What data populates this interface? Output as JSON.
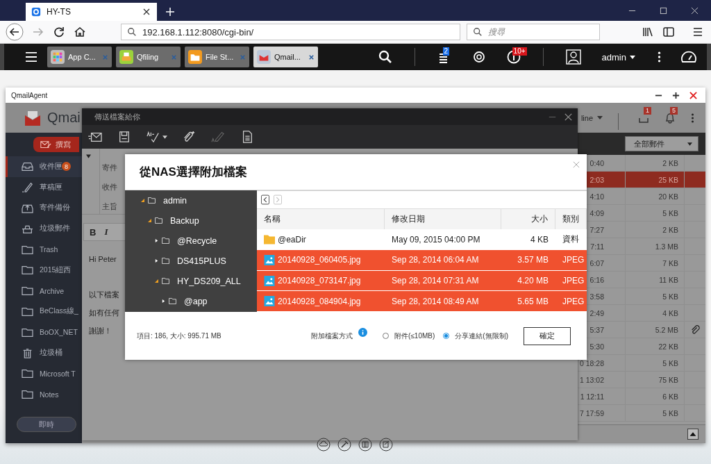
{
  "browser": {
    "tab_title": "HY-TS",
    "url": "192.168.1.112:8080/cgi-bin/",
    "search_placeholder": "搜尋"
  },
  "qts_bar": {
    "apps": [
      {
        "label": "App C...",
        "kind": "appcenter",
        "selected": false
      },
      {
        "label": "Qfiling",
        "kind": "qfiling",
        "selected": false
      },
      {
        "label": "File St...",
        "kind": "filestation",
        "selected": false
      },
      {
        "label": "Qmail...",
        "kind": "qmail",
        "selected": true
      }
    ],
    "task_badge": "2",
    "info_badge": "10+",
    "user": "admin"
  },
  "qmail_window": {
    "title": "QmailAgent",
    "logo_text": "Qmai",
    "compose_button": "撰寫",
    "folders": [
      {
        "label": "收件匣",
        "kind": "inbox",
        "count": "8",
        "selected": true
      },
      {
        "label": "草稿匣",
        "kind": "drafts",
        "selected": false
      },
      {
        "label": "寄件備份",
        "kind": "sent",
        "selected": false
      },
      {
        "label": "垃圾郵件",
        "kind": "spam",
        "selected": false
      },
      {
        "label": "Trash",
        "kind": "folder",
        "selected": false
      },
      {
        "label": "2015紐西",
        "kind": "folder",
        "selected": false
      },
      {
        "label": "Archive",
        "kind": "folder",
        "selected": false
      },
      {
        "label": "BeClass線_",
        "kind": "folder",
        "selected": false
      },
      {
        "label": "BoOX_NET",
        "kind": "folder",
        "selected": false
      },
      {
        "label": "垃圾桶",
        "kind": "trash",
        "selected": false
      },
      {
        "label": "Microsoft T",
        "kind": "folder",
        "selected": false
      },
      {
        "label": "Notes",
        "kind": "folder",
        "selected": false
      }
    ],
    "live_button": "即時",
    "status_menu": "line",
    "mailbox_badge": "1",
    "bell_badge": "5",
    "mail_filter": "全部郵件",
    "messages": [
      {
        "time": "0:40",
        "size": "2 KB",
        "selected": false,
        "attachment": false
      },
      {
        "time": "2:03",
        "size": "25 KB",
        "selected": true,
        "attachment": false
      },
      {
        "time": "4:10",
        "size": "20 KB",
        "selected": false,
        "attachment": false
      },
      {
        "time": "4:09",
        "size": "5 KB",
        "selected": false,
        "attachment": false
      },
      {
        "time": "7:27",
        "size": "2 KB",
        "selected": false,
        "attachment": false
      },
      {
        "time": "7:11",
        "size": "1.3 MB",
        "selected": false,
        "attachment": false
      },
      {
        "time": "6:07",
        "size": "7 KB",
        "selected": false,
        "attachment": false
      },
      {
        "time": "6:16",
        "size": "11 KB",
        "selected": false,
        "attachment": false
      },
      {
        "time": "3:58",
        "size": "5 KB",
        "selected": false,
        "attachment": false
      },
      {
        "time": "2:49",
        "size": "4 KB",
        "selected": false,
        "attachment": false
      },
      {
        "time": "5:37",
        "size": "5.2 MB",
        "selected": false,
        "attachment": true
      },
      {
        "time": "5:30",
        "size": "22 KB",
        "selected": false,
        "attachment": false
      },
      {
        "time": "0 18:28",
        "size": "5 KB",
        "selected": false,
        "attachment": false
      },
      {
        "time": "1 13:02",
        "size": "75 KB",
        "selected": false,
        "attachment": false
      },
      {
        "time": "1 12:11",
        "size": "6 KB",
        "selected": false,
        "attachment": false
      },
      {
        "time": "7 17:59",
        "size": "5 KB",
        "selected": false,
        "attachment": false
      }
    ]
  },
  "compose": {
    "title": "傳送檔案給你",
    "tools": [
      {
        "kind": "send",
        "disabled": false
      },
      {
        "kind": "save",
        "disabled": false
      },
      {
        "kind": "spell",
        "disabled": false
      },
      {
        "kind": "attach",
        "disabled": false
      },
      {
        "kind": "sign",
        "disabled": true
      },
      {
        "kind": "template",
        "disabled": false
      }
    ],
    "fields": [
      "寄件",
      "收件",
      "主旨"
    ],
    "format_buttons": [
      "B",
      "I"
    ],
    "body": [
      "Hi Peter",
      "以下檔案",
      "如有任何",
      "謝謝！"
    ]
  },
  "dialog": {
    "title": "從NAS選擇附加檔案",
    "tree": [
      {
        "label": "admin",
        "expanded": true,
        "children": [
          {
            "label": "Backup",
            "expanded": true,
            "children": [
              {
                "label": "@Recycle",
                "expanded": false
              },
              {
                "label": "DS415PLUS",
                "expanded": false
              },
              {
                "label": "HY_DS209_ALL",
                "expanded": true,
                "children": [
                  {
                    "label": "@app",
                    "expanded": false
                  }
                ]
              }
            ]
          }
        ]
      }
    ],
    "history_buttons": [
      {
        "kind": "back",
        "disabled": false
      },
      {
        "kind": "forward",
        "disabled": true
      }
    ],
    "columns": [
      "名稱",
      "修改日期",
      "大小",
      "類別"
    ],
    "files": [
      {
        "name": "@eaDir",
        "modified": "May 09, 2015 04:00 PM",
        "size": "4 KB",
        "type": "資料",
        "kind": "folder",
        "selected": false
      },
      {
        "name": "20140928_060405.jpg",
        "modified": "Sep 28, 2014 06:04 AM",
        "size": "3.57 MB",
        "type": "JPEG",
        "kind": "image",
        "selected": true
      },
      {
        "name": "20140928_073147.jpg",
        "modified": "Sep 28, 2014 07:31 AM",
        "size": "4.20 MB",
        "type": "JPEG",
        "kind": "image",
        "selected": true
      },
      {
        "name": "20140928_084904.jpg",
        "modified": "Sep 28, 2014 08:49 AM",
        "size": "5.65 MB",
        "type": "JPEG",
        "kind": "image",
        "selected": true
      }
    ],
    "summary": "項目: 186, 大小: 995.71 MB",
    "method_label": "附加檔案方式",
    "options": [
      {
        "label": "附件(≤10MB)",
        "selected": false
      },
      {
        "label": "分享連結(無限制)",
        "selected": true
      }
    ],
    "confirm": "確定"
  }
}
